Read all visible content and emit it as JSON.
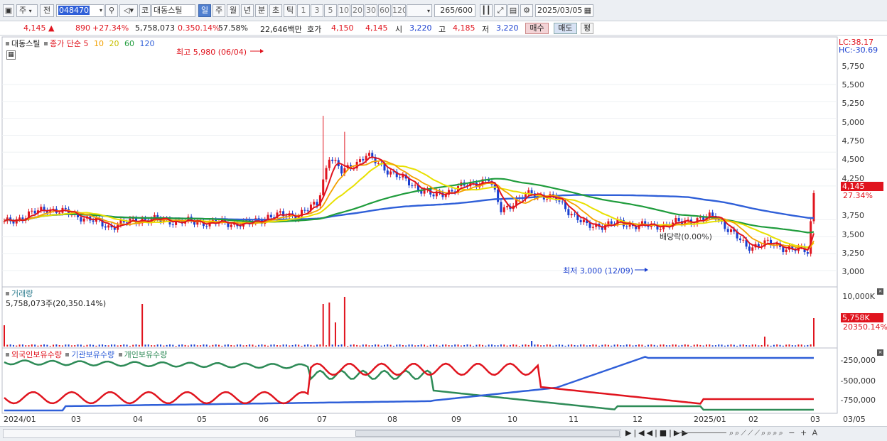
{
  "toolbar": {
    "type_label": "주",
    "prev_label": "전",
    "code": "048470",
    "market_label": "코",
    "stock_name": "대동스틸",
    "period_tabs": [
      "일",
      "주",
      "월",
      "년",
      "분",
      "초",
      "틱"
    ],
    "interval_options": [
      "1",
      "3",
      "5",
      "10",
      "20",
      "30",
      "60",
      "120"
    ],
    "count": "265",
    "count_total": "/600",
    "date": "2025/03/05"
  },
  "info": {
    "price": "4,145",
    "change": "890",
    "change_pct": "+27.34%",
    "volume": "5,758,073",
    "volume_pct": "0.350.14%",
    "turnover": "57.58%",
    "amount": "22,646백만",
    "hoga_label": "호가",
    "ask": "4,150",
    "bid": "4,145",
    "open_label": "시",
    "open": "3,220",
    "high_label": "고",
    "high": "4,185",
    "low_label": "저",
    "low": "3,220",
    "buy_label": "매수",
    "sell_label": "매도",
    "eval_label": "평"
  },
  "price_panel": {
    "stock_name": "대동스틸",
    "ma_label": "종가 단순",
    "ma_periods": [
      "5",
      "10",
      "20",
      "60",
      "120"
    ],
    "ma_colors": [
      "#e0141e",
      "#f3a100",
      "#e8e000",
      "#1f9c3c",
      "#2f5fd8"
    ],
    "lc": "LC:38.17",
    "hc": "HC:-30.69",
    "high_annotation": "최고 5,980 (06/04)",
    "low_annotation": "최저 3,000 (12/09)",
    "dividend_annotation": "배당락(0.00%)",
    "y_ticks": [
      "5,750",
      "5,500",
      "5,250",
      "5,000",
      "4,750",
      "4,500",
      "4,250",
      "3,750",
      "3,500",
      "3,250",
      "3,000"
    ],
    "current_price_tag": "4,145",
    "current_pct_tag": "27.34%"
  },
  "volume_panel": {
    "title": "거래량",
    "value": "5,758,073주(20,350.14%)",
    "y_tick": "10,000K",
    "current_tag": "5,758K",
    "current_pct": "20350.14%"
  },
  "holding_panel": {
    "legend": [
      "외국인보유수량",
      "기관보유수량",
      "개인보유수량"
    ],
    "colors": [
      "#e0141e",
      "#2f5fd8",
      "#2e8b57"
    ],
    "y_ticks": [
      "-250,000",
      "-500,000",
      "-750,000"
    ]
  },
  "x_axis": {
    "ticks": [
      "2024/01",
      "03",
      "04",
      "05",
      "06",
      "07",
      "08",
      "09",
      "10",
      "11",
      "12",
      "2025/01",
      "02",
      "03"
    ],
    "right_date": "03/05"
  }
}
